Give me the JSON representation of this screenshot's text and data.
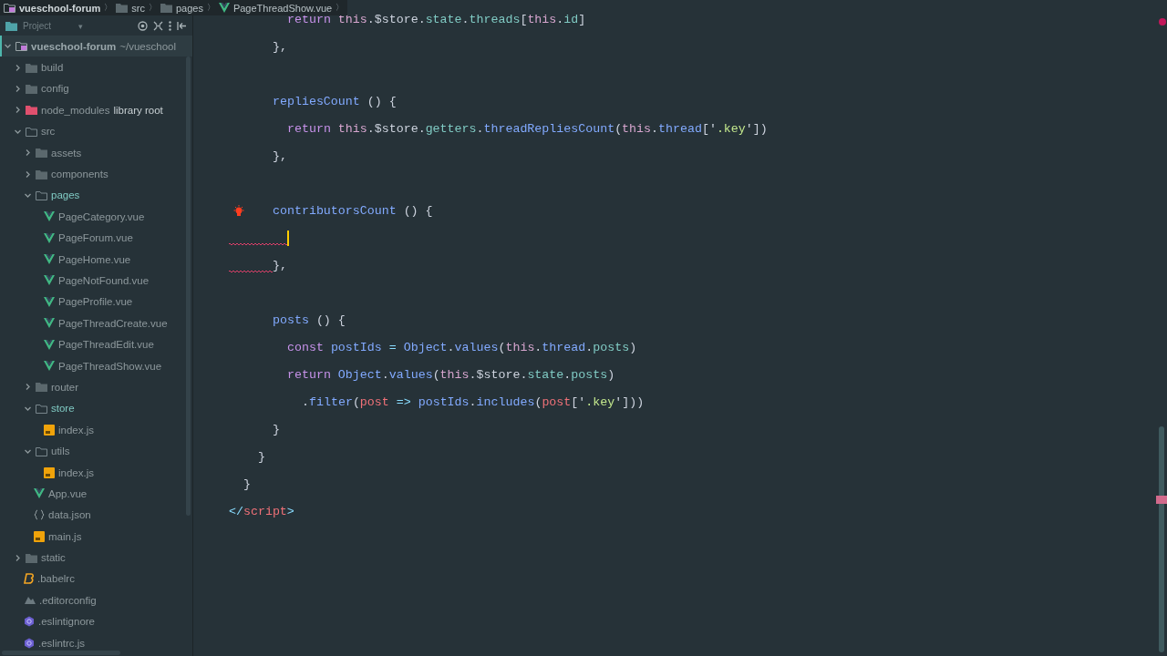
{
  "breadcrumb": [
    {
      "label": "vueschool-forum",
      "kind": "project",
      "separator": "〉"
    },
    {
      "label": "src",
      "kind": "folder",
      "separator": "〉"
    },
    {
      "label": "pages",
      "kind": "folder",
      "separator": "〉"
    },
    {
      "label": "PageThreadShow.vue",
      "kind": "vue",
      "separator": "〉"
    }
  ],
  "project_panel": {
    "title": "Project",
    "dropdown": "▾"
  },
  "tree": [
    {
      "name": "vueschool-forum",
      "suffix": "~/vueschool",
      "kind": "project",
      "expanded": true,
      "selected": true,
      "children": [
        {
          "name": "build",
          "kind": "folder",
          "expanded": false,
          "selected": false
        },
        {
          "name": "config",
          "kind": "folder",
          "expanded": false,
          "selected": false
        },
        {
          "name": "node_modules",
          "suffix": "library root",
          "kind": "excluded",
          "expanded": false,
          "selected": false
        },
        {
          "name": "src",
          "kind": "folder",
          "expanded": true,
          "selected": false,
          "children": [
            {
              "name": "assets",
              "kind": "folder",
              "expanded": false,
              "selected": false
            },
            {
              "name": "components",
              "kind": "folder",
              "expanded": false,
              "selected": false
            },
            {
              "name": "pages",
              "kind": "folder",
              "expanded": true,
              "selected": false,
              "highlighted": true,
              "children": [
                {
                  "name": "PageCategory.vue",
                  "kind": "vue",
                  "selected": false
                },
                {
                  "name": "PageForum.vue",
                  "kind": "vue",
                  "selected": false
                },
                {
                  "name": "PageHome.vue",
                  "kind": "vue",
                  "selected": false
                },
                {
                  "name": "PageNotFound.vue",
                  "kind": "vue",
                  "selected": false
                },
                {
                  "name": "PageProfile.vue",
                  "kind": "vue",
                  "selected": false
                },
                {
                  "name": "PageThreadCreate.vue",
                  "kind": "vue",
                  "selected": false
                },
                {
                  "name": "PageThreadEdit.vue",
                  "kind": "vue",
                  "selected": false
                },
                {
                  "name": "PageThreadShow.vue",
                  "kind": "vue",
                  "selected": false
                }
              ]
            },
            {
              "name": "router",
              "kind": "folder",
              "expanded": false,
              "selected": false
            },
            {
              "name": "store",
              "kind": "folder",
              "expanded": true,
              "selected": false,
              "highlighted": true,
              "children": [
                {
                  "name": "index.js",
                  "kind": "js",
                  "selected": false
                }
              ]
            },
            {
              "name": "utils",
              "kind": "folder",
              "expanded": true,
              "selected": false,
              "children": [
                {
                  "name": "index.js",
                  "kind": "js",
                  "selected": false
                }
              ]
            },
            {
              "name": "App.vue",
              "kind": "vue",
              "selected": false
            },
            {
              "name": "data.json",
              "kind": "json",
              "selected": false
            },
            {
              "name": "main.js",
              "kind": "js",
              "selected": false
            }
          ]
        },
        {
          "name": "static",
          "kind": "folder",
          "expanded": false,
          "selected": false
        },
        {
          "name": ".babelrc",
          "kind": "babel",
          "selected": false
        },
        {
          "name": ".editorconfig",
          "kind": "config",
          "selected": false
        },
        {
          "name": ".eslintignore",
          "kind": "eslint",
          "selected": false
        },
        {
          "name": ".eslintrc.js",
          "kind": "eslint",
          "selected": false
        }
      ]
    }
  ],
  "code": [
    {
      "kind": "group",
      "children": [
        {
          "kind": "group",
          "children": [
            {
              "kind": "group",
              "children": [
                {
                  "kind": "group",
                  "children": [
                    {
                      "kind": "line",
                      "tokens": [
                        {
                          "t": "return",
                          "kind": "keyword"
                        },
                        {
                          "t": " this",
                          "kind": "this"
                        },
                        {
                          "t": ".$store.",
                          "kind": "plain"
                        },
                        {
                          "t": "state",
                          "kind": "prop"
                        },
                        {
                          "t": ".",
                          "kind": "plain"
                        },
                        {
                          "t": "threads",
                          "kind": "prop"
                        },
                        {
                          "t": "[",
                          "kind": "plain"
                        },
                        {
                          "t": "this",
                          "kind": "this"
                        },
                        {
                          "t": ".",
                          "kind": "plain"
                        },
                        {
                          "t": "id",
                          "kind": "prop"
                        },
                        {
                          "t": "]",
                          "kind": "plain"
                        }
                      ]
                    }
                  ]
                },
                {
                  "kind": "line",
                  "tokens": [
                    {
                      "t": "},",
                      "kind": "plain"
                    }
                  ]
                },
                {
                  "kind": "blank"
                },
                {
                  "kind": "line",
                  "tokens": [
                    {
                      "t": "repliesCount",
                      "kind": "fn"
                    },
                    {
                      "t": " () {",
                      "kind": "plain"
                    }
                  ],
                  "children": [
                    {
                      "kind": "line",
                      "tokens": [
                        {
                          "t": "return",
                          "kind": "keyword"
                        },
                        {
                          "t": " this",
                          "kind": "this"
                        },
                        {
                          "t": ".$store.",
                          "kind": "plain"
                        },
                        {
                          "t": "getters",
                          "kind": "prop"
                        },
                        {
                          "t": ".",
                          "kind": "plain"
                        },
                        {
                          "t": "threadRepliesCount",
                          "kind": "fn"
                        },
                        {
                          "t": "(",
                          "kind": "plain"
                        },
                        {
                          "t": "this",
                          "kind": "this"
                        },
                        {
                          "t": ".",
                          "kind": "plain"
                        },
                        {
                          "t": "thread",
                          "kind": "fn"
                        },
                        {
                          "t": "['",
                          "kind": "plain"
                        },
                        {
                          "t": ".key",
                          "kind": "string"
                        },
                        {
                          "t": "'])",
                          "kind": "plain"
                        }
                      ]
                    }
                  ]
                },
                {
                  "kind": "line",
                  "tokens": [
                    {
                      "t": "},",
                      "kind": "plain"
                    }
                  ]
                },
                {
                  "kind": "blank"
                },
                {
                  "kind": "line",
                  "bulb": true,
                  "tokens": [
                    {
                      "t": "contributorsCount",
                      "kind": "fn"
                    },
                    {
                      "t": " () {",
                      "kind": "plain"
                    }
                  ],
                  "children": [
                    {
                      "kind": "line",
                      "error": true,
                      "caret": true
                    }
                  ]
                },
                {
                  "kind": "line",
                  "error": true,
                  "tokens": [
                    {
                      "t": "},",
                      "kind": "plain"
                    }
                  ]
                },
                {
                  "kind": "blank"
                },
                {
                  "kind": "line",
                  "tokens": [
                    {
                      "t": "posts",
                      "kind": "fn"
                    },
                    {
                      "t": " () {",
                      "kind": "plain"
                    }
                  ],
                  "children": [
                    {
                      "kind": "line",
                      "tokens": [
                        {
                          "t": "const",
                          "kind": "keyword"
                        },
                        {
                          "t": " postIds ",
                          "kind": "fn"
                        },
                        {
                          "t": "=",
                          "kind": "op"
                        },
                        {
                          "t": " Object",
                          "kind": "fn"
                        },
                        {
                          "t": ".",
                          "kind": "plain"
                        },
                        {
                          "t": "values",
                          "kind": "fn"
                        },
                        {
                          "t": "(",
                          "kind": "plain"
                        },
                        {
                          "t": "this",
                          "kind": "this"
                        },
                        {
                          "t": ".",
                          "kind": "plain"
                        },
                        {
                          "t": "thread",
                          "kind": "fn"
                        },
                        {
                          "t": ".",
                          "kind": "plain"
                        },
                        {
                          "t": "posts",
                          "kind": "prop"
                        },
                        {
                          "t": ")",
                          "kind": "plain"
                        }
                      ]
                    },
                    {
                      "kind": "line",
                      "tokens": [
                        {
                          "t": "return",
                          "kind": "keyword"
                        },
                        {
                          "t": " Object",
                          "kind": "fn"
                        },
                        {
                          "t": ".",
                          "kind": "plain"
                        },
                        {
                          "t": "values",
                          "kind": "fn"
                        },
                        {
                          "t": "(",
                          "kind": "plain"
                        },
                        {
                          "t": "this",
                          "kind": "this"
                        },
                        {
                          "t": ".$store.",
                          "kind": "plain"
                        },
                        {
                          "t": "state",
                          "kind": "prop"
                        },
                        {
                          "t": ".",
                          "kind": "plain"
                        },
                        {
                          "t": "posts",
                          "kind": "prop"
                        },
                        {
                          "t": ")",
                          "kind": "plain"
                        }
                      ],
                      "children": [
                        {
                          "kind": "line",
                          "tokens": [
                            {
                              "t": ".",
                              "kind": "plain"
                            },
                            {
                              "t": "filter",
                              "kind": "fn"
                            },
                            {
                              "t": "(",
                              "kind": "plain"
                            },
                            {
                              "t": "post",
                              "kind": "param"
                            },
                            {
                              "t": " => ",
                              "kind": "op"
                            },
                            {
                              "t": "postIds",
                              "kind": "fn"
                            },
                            {
                              "t": ".",
                              "kind": "plain"
                            },
                            {
                              "t": "includes",
                              "kind": "fn"
                            },
                            {
                              "t": "(",
                              "kind": "plain"
                            },
                            {
                              "t": "post",
                              "kind": "param"
                            },
                            {
                              "t": "['",
                              "kind": "plain"
                            },
                            {
                              "t": ".key",
                              "kind": "string"
                            },
                            {
                              "t": "']))",
                              "kind": "plain"
                            }
                          ]
                        }
                      ]
                    }
                  ]
                },
                {
                  "kind": "line",
                  "tokens": [
                    {
                      "t": "}",
                      "kind": "plain"
                    }
                  ]
                }
              ]
            },
            {
              "kind": "line",
              "tokens": [
                {
                  "t": "}",
                  "kind": "plain"
                }
              ]
            }
          ]
        },
        {
          "kind": "line",
          "tokens": [
            {
              "t": "}",
              "kind": "plain"
            }
          ]
        }
      ]
    },
    {
      "kind": "line",
      "tokens": [
        {
          "t": "</",
          "kind": "op"
        },
        {
          "t": "script",
          "kind": "param"
        },
        {
          "t": ">",
          "kind": "op"
        }
      ]
    }
  ]
}
